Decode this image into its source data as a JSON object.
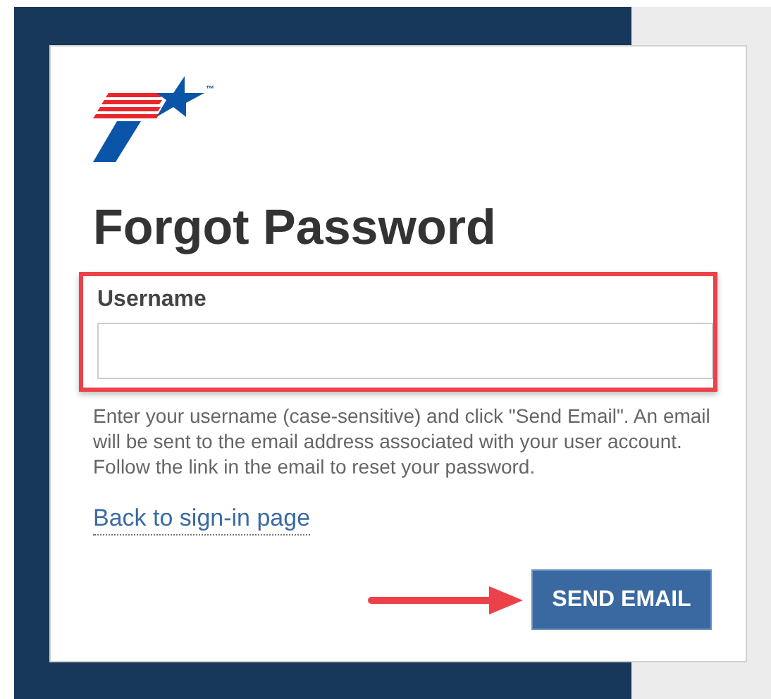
{
  "logo": {
    "trademark": "™"
  },
  "title": "Forgot Password",
  "username_field": {
    "label": "Username",
    "highlighted": true
  },
  "help_text": "Enter your username (case-sensitive) and click \"Send Email\". An email will be sent to the email address associated with your user account. Follow the link in the email to reset your password.",
  "back_link": "Back to sign-in page",
  "send_button": {
    "label": "SEND EMAIL",
    "arrow_pointer": true
  }
}
